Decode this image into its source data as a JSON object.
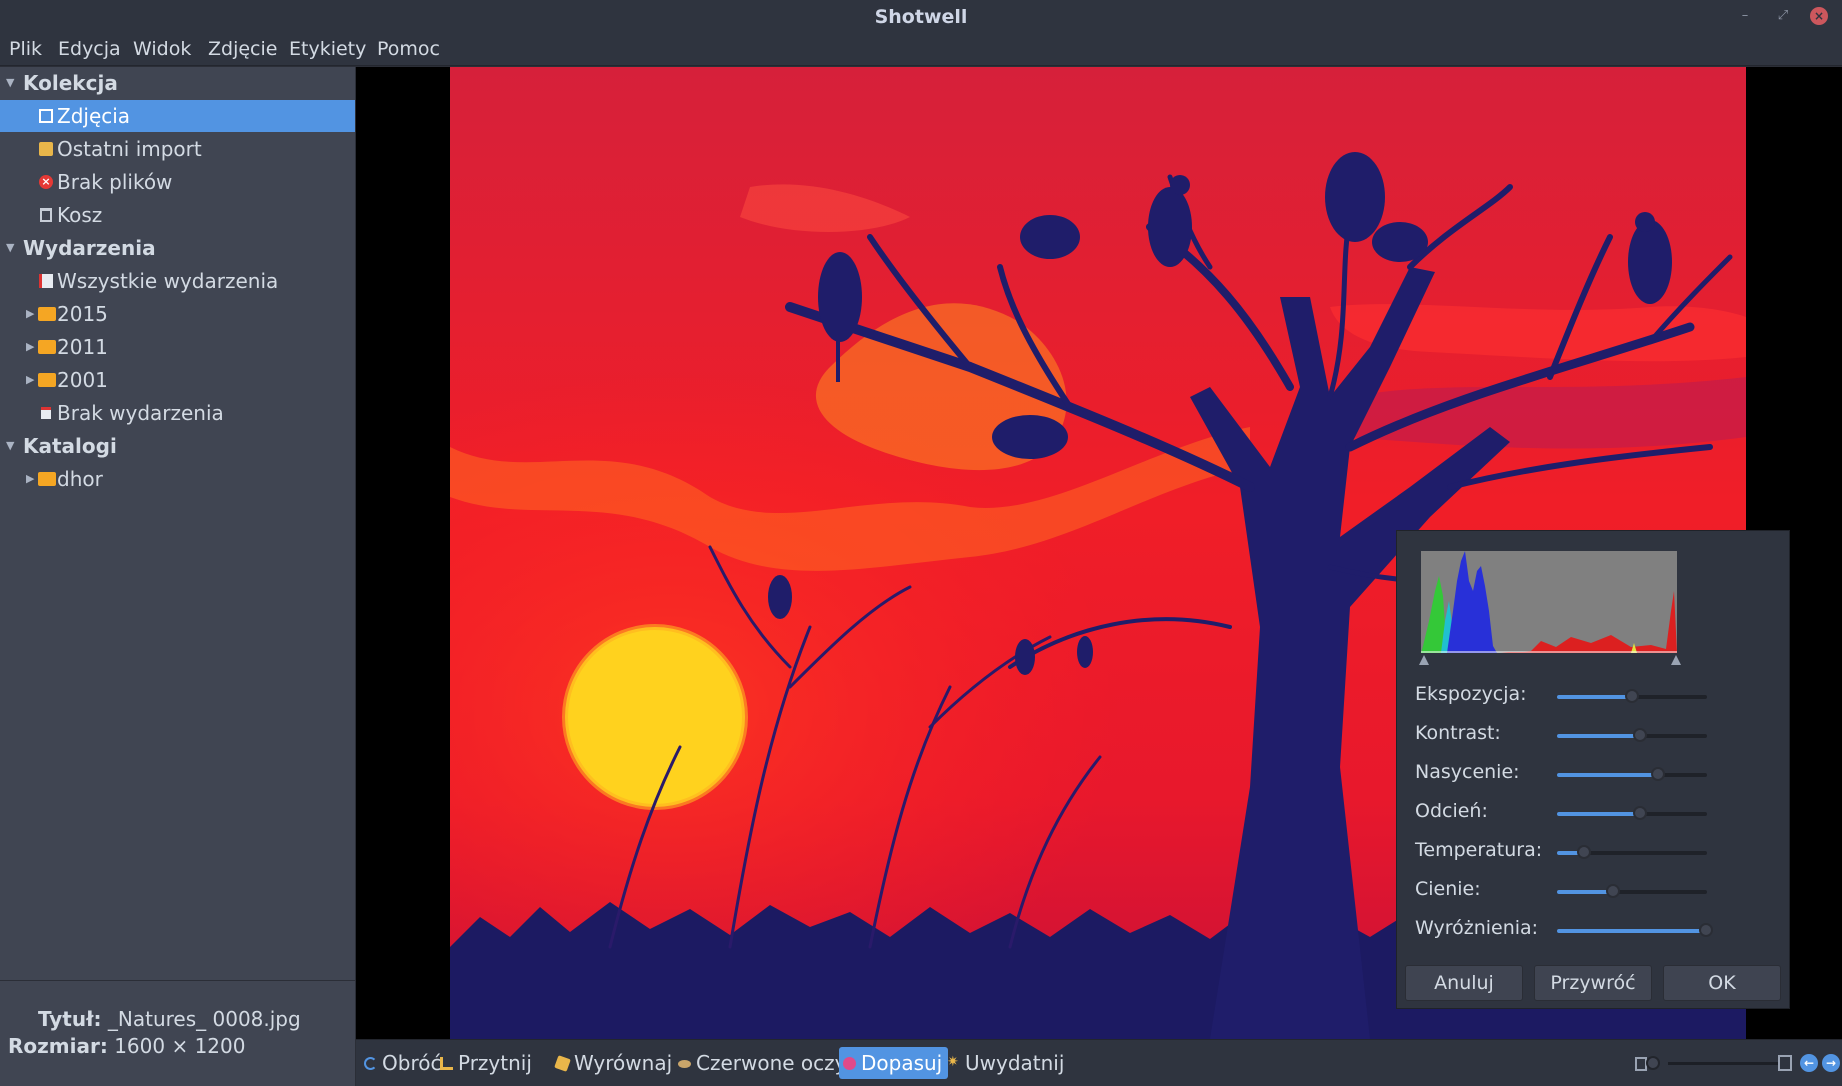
{
  "window": {
    "title": "Shotwell"
  },
  "menu": [
    "Plik",
    "Edycja",
    "Widok",
    "Zdjęcie",
    "Etykiety",
    "Pomoc"
  ],
  "sidebar": {
    "collection": {
      "header": "Kolekcja",
      "items": [
        "Zdjęcia",
        "Ostatni import",
        "Brak plików",
        "Kosz"
      ]
    },
    "events": {
      "header": "Wydarzenia",
      "all": "Wszystkie wydarzenia",
      "years": [
        "2015",
        "2011",
        "2001"
      ],
      "no_event": "Brak wydarzenia"
    },
    "catalogs": {
      "header": "Katalogi",
      "items": [
        "dhor"
      ]
    }
  },
  "info": {
    "title_label": "Tytuł:",
    "title_value": "_Natures_ 0008.jpg",
    "size_label": "Rozmiar:",
    "size_value": "1600 × 1200"
  },
  "adjust": {
    "sliders": [
      {
        "label": "Ekspozycja:",
        "value": 0.5
      },
      {
        "label": "Kontrast:",
        "value": 0.55
      },
      {
        "label": "Nasycenie:",
        "value": 0.67
      },
      {
        "label": "Odcień:",
        "value": 0.55
      },
      {
        "label": "Temperatura:",
        "value": 0.18
      },
      {
        "label": "Cienie:",
        "value": 0.37
      },
      {
        "label": "Wyróżnienia:",
        "value": 0.99
      }
    ],
    "buttons": {
      "cancel": "Anuluj",
      "reset": "Przywróć",
      "ok": "OK"
    }
  },
  "toolbar": {
    "tools": [
      "Obróć",
      "Przytnij",
      "Wyrównaj",
      "Czerwone oczy",
      "Dopasuj",
      "Uwydatnij"
    ],
    "active": "Dopasuj"
  },
  "colors": {
    "accent": "#5294e2",
    "sidebar": "#404552",
    "panel": "#2f343f"
  }
}
